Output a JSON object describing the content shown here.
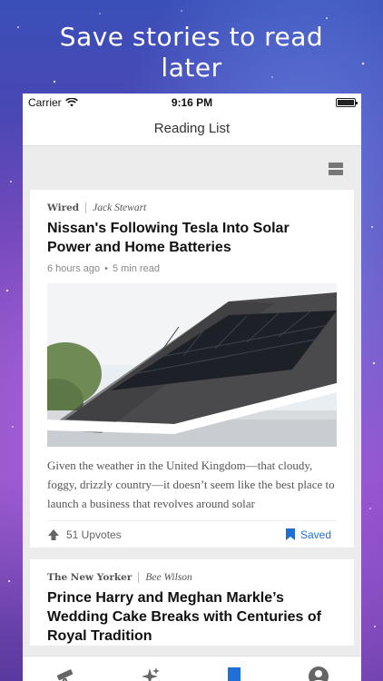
{
  "promo": {
    "line1": "Save stories to read",
    "line2": "later"
  },
  "status": {
    "carrier": "Carrier",
    "time": "9:16 PM"
  },
  "nav": {
    "title": "Reading List"
  },
  "articles": [
    {
      "publication": "Wired",
      "author": "Jack Stewart",
      "title": "Nissan's Following Tesla Into Solar Power and Home Batteries",
      "age": "6 hours ago",
      "read_time": "5 min read",
      "excerpt": "Given the weather in the United Kingdom—that cloudy, foggy, drizzly country—it doesn’t seem like the best place to launch a business that revolves around solar",
      "upvotes": "51 Upvotes",
      "saved_label": "Saved"
    },
    {
      "publication": "The New Yorker",
      "author": "Bee Wilson",
      "title": "Prince Harry and Meghan Markle’s Wedding Cake Breaks with Centuries of Royal Tradition"
    }
  ],
  "tabs": [
    "telescope-icon",
    "sparkles-icon",
    "bookmark-icon",
    "profile-icon"
  ],
  "colors": {
    "accent": "#1f6fd6",
    "tab_inactive": "#666666"
  }
}
